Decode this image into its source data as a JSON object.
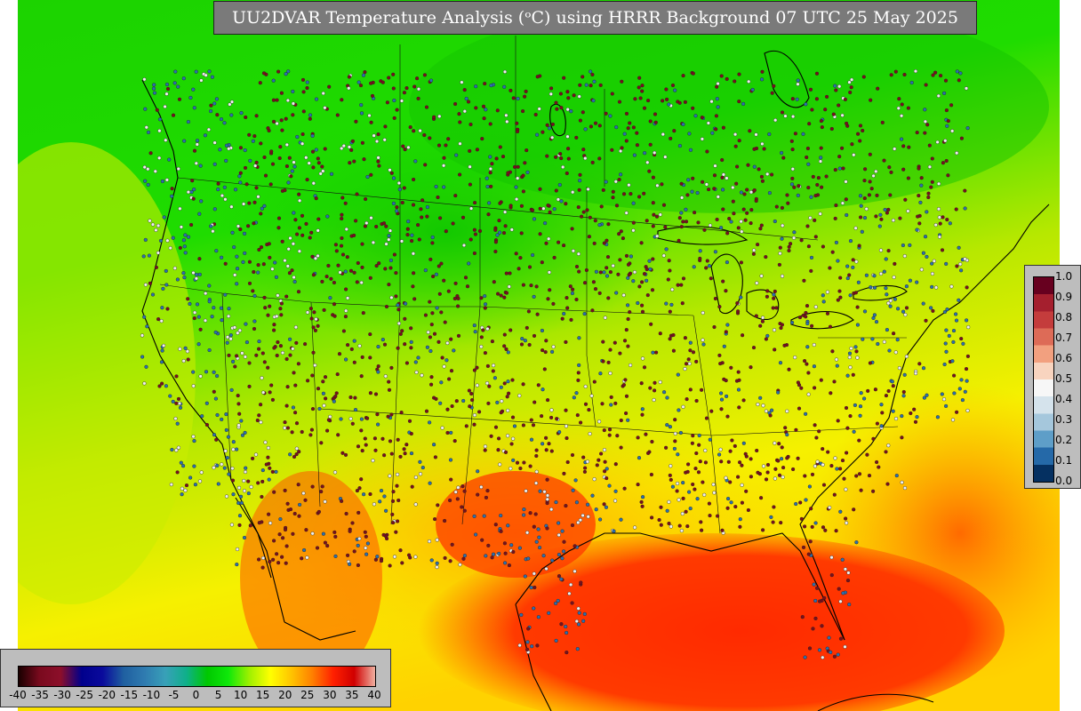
{
  "title": "UU2DVAR Temperature Analysis (ᵒC) using HRRR Background 07 UTC 25 May 2025",
  "map": {
    "field": "temperature",
    "palette": {
      "cold": "#00c800",
      "mild": "#d8ef00",
      "warm": "#ffc400",
      "hot": "#ff2a00"
    },
    "coastline_color": "#000000",
    "station_markers": {
      "low": "#2b6fb0",
      "mid": "#f0f0f0",
      "high": "#7a0f1c"
    }
  },
  "colorbar_right": {
    "ticks": [
      "1.0",
      "0.9",
      "0.8",
      "0.7",
      "0.6",
      "0.5",
      "0.4",
      "0.3",
      "0.2",
      "0.1",
      "0.0"
    ],
    "colors": [
      "#67001f",
      "#a51f2e",
      "#c43c3c",
      "#dd6b57",
      "#f2a07f",
      "#f8d4bf",
      "#f7f7f7",
      "#d5e3ec",
      "#a5c7dc",
      "#5e9ec8",
      "#2569a8",
      "#053061"
    ]
  },
  "colorbar_bottom": {
    "ticks": [
      "-40",
      "-35",
      "-30",
      "-25",
      "-20",
      "-15",
      "-10",
      "-5",
      "0",
      "5",
      "10",
      "15",
      "20",
      "25",
      "30",
      "35",
      "40"
    ],
    "stops": [
      "#1a0000",
      "#7a0a1e",
      "#8c0f2a",
      "#00008c",
      "#0a0a9c",
      "#1f5fa0",
      "#2f7bb0",
      "#38a0b8",
      "#0fb08a",
      "#00c800",
      "#0fe80a",
      "#9ff000",
      "#ffff00",
      "#ffc400",
      "#ff8000",
      "#ff2000",
      "#d00000",
      "#f0b0a0"
    ]
  }
}
